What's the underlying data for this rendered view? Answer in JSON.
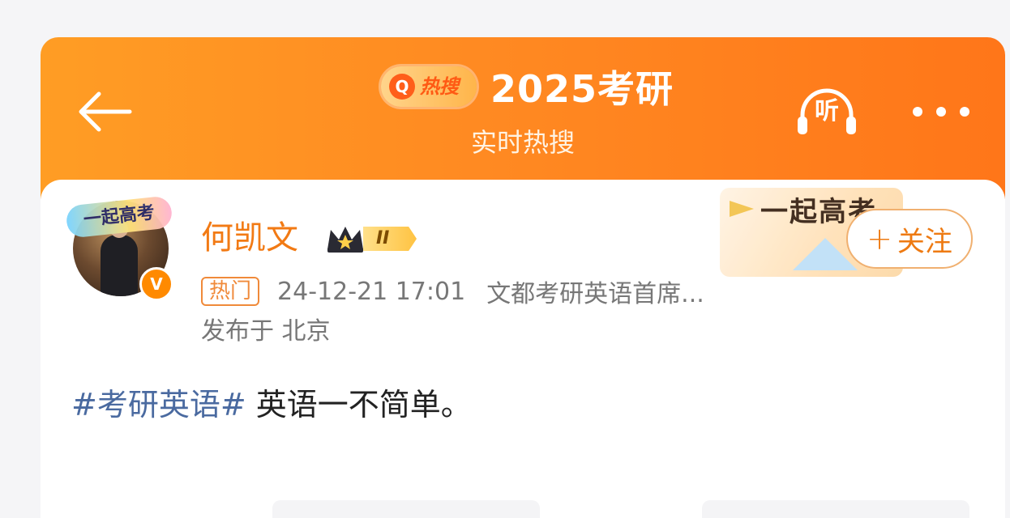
{
  "header": {
    "badge_icon": "search-icon",
    "badge_label": "热搜",
    "title": "2025考研",
    "subtitle": "实时热搜",
    "listen_label": "听",
    "colors": {
      "gradient_start": "#ff9d24",
      "gradient_end": "#ff7619"
    }
  },
  "post": {
    "avatar_frame_text": "一起高考",
    "verify_mark": "V",
    "username": "何凯文",
    "vip_level": "II",
    "theme_decoration_text": "一起高考",
    "follow_label": "关注",
    "hot_tag": "热门",
    "timestamp": "24-12-21 17:01",
    "source": "文都考研英语首席...",
    "location": "发布于 北京",
    "hashtag": "#考研英语#",
    "text": " 英语一不简单。"
  }
}
